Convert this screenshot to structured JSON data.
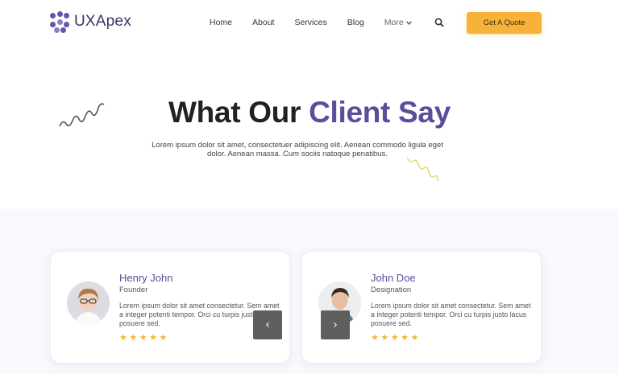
{
  "brand": {
    "logo_prefix": "UX",
    "logo_suffix": "Apex"
  },
  "nav": {
    "items": [
      "Home",
      "About",
      "Services",
      "Blog"
    ],
    "more_label": "More",
    "cta_label": "Get A Quote"
  },
  "hero": {
    "title_plain": "What Our",
    "title_accent": "Client Say",
    "subtitle": "Lorem ipsum dolor sit amet, consectetuer adipiscing elit. Aenean commodo ligula eget dolor. Aenean massa. Cum sociis natoque penatibus."
  },
  "testimonials": [
    {
      "name": "Henry John",
      "role": "Founder",
      "quote": "Lorem ipsum dolor sit amet consectetur. Sem amet a integer potenti tempor. Orci cu turpis justo lacus posuere sed.",
      "stars": "★★★★★"
    },
    {
      "name": "John Doe",
      "role": "Designation",
      "quote": "Lorem ipsum dolor sit amet consectetur. Sem amet a integer potenti tempor. Orci cu turpis justo lacus posuere sed.",
      "stars": "★★★★★"
    }
  ],
  "carousel": {
    "prev_glyph": "‹",
    "next_glyph": "›"
  },
  "colors": {
    "accent": "#5a4d9c",
    "cta": "#f7b339",
    "star": "#f5b731",
    "band": "#f8f8fd"
  }
}
